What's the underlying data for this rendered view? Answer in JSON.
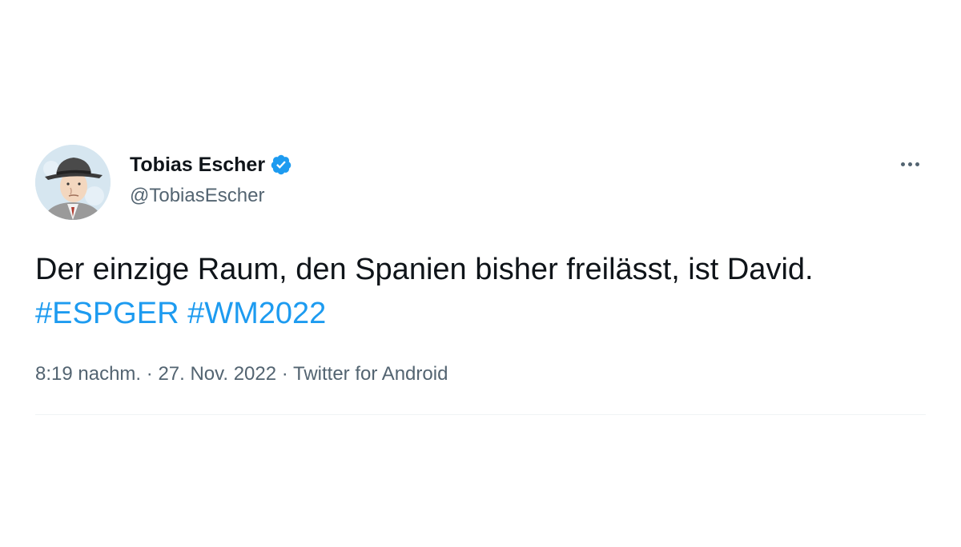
{
  "tweet": {
    "author": {
      "display_name": "Tobias Escher",
      "handle": "@TobiasEscher",
      "verified": true,
      "avatar_icon": "illustrated-man-with-fedora-avatar"
    },
    "more_icon": "more-options-icon",
    "text_plain": "Der einzige Raum, den Spanien bisher freilässt, ist David.",
    "hashtags": [
      "#ESPGER",
      "#WM2022"
    ],
    "time": "8:19 nachm.",
    "date": "27. Nov. 2022",
    "source": "Twitter for Android",
    "separator": "·"
  },
  "colors": {
    "text": "#0f1419",
    "secondary": "#536471",
    "accent": "#1d9bf0",
    "divider": "#eff3f4"
  }
}
